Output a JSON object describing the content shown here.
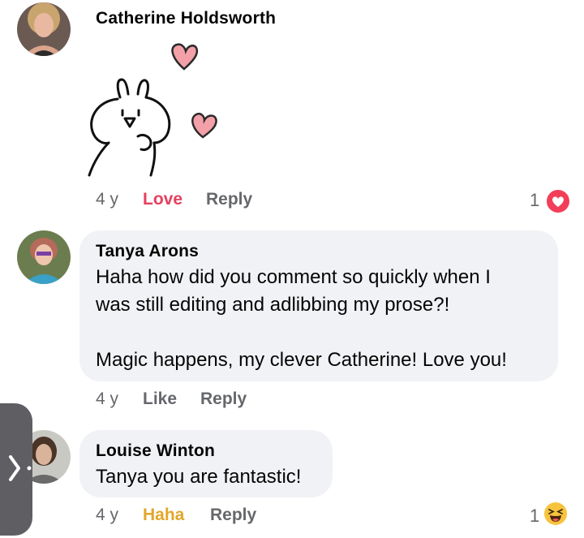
{
  "comments": [
    {
      "author": "Catherine Holdsworth",
      "age": "4 y",
      "reaction_label": "Love",
      "reaction_color": "#e4405f",
      "reply_label": "Reply",
      "reaction_count": "1",
      "reaction_icon": "heart-icon",
      "sticker": "bunny-hearts-sticker"
    },
    {
      "author": "Tanya Arons",
      "lines": [
        "Haha how did you comment so quickly when I",
        "was still editing and adlibbing my prose?!",
        "Magic happens, my clever Catherine!  Love you!"
      ],
      "age": "4 y",
      "like_label": "Like",
      "reply_label": "Reply"
    },
    {
      "author": "Louise Winton",
      "text": "Tanya you are fantastic!",
      "age": "4 y",
      "reaction_label": "Haha",
      "reaction_color": "#e3a62a",
      "reply_label": "Reply",
      "reaction_count": "1",
      "reaction_icon": "haha-emoji-icon"
    }
  ],
  "side_handle_icon": "chevron-right-icon",
  "colors": {
    "bubble_bg": "#f0f2f5",
    "meta_text": "#65676b",
    "side_handle": "#5f5f63"
  }
}
